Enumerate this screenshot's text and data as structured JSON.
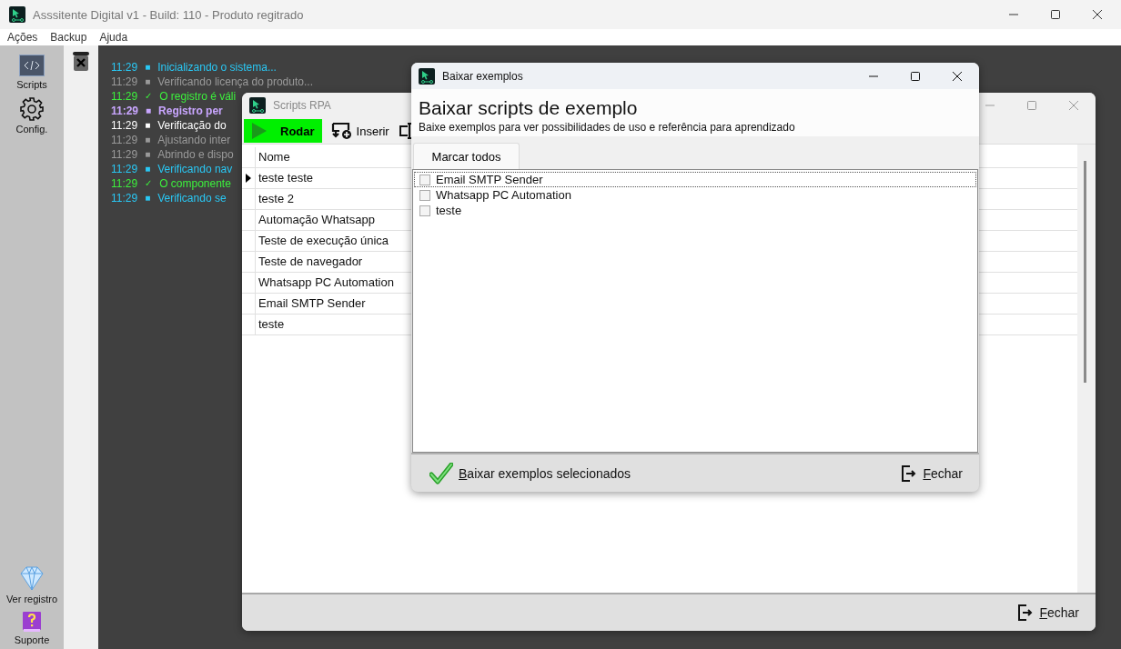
{
  "main_window": {
    "title": "Asssitente Digital v1 - Build: 110 - Produto regitrado",
    "menu": [
      "Ações",
      "Backup",
      "Ajuda"
    ]
  },
  "sidebar": {
    "items": [
      {
        "label": "Scripts",
        "kind": "code"
      },
      {
        "label": "Config.",
        "kind": "gear"
      },
      {
        "label": "Ver registro",
        "kind": "diamond"
      },
      {
        "label": "Suporte",
        "kind": "help"
      }
    ]
  },
  "log": [
    {
      "time": "11:29",
      "mark": "■",
      "text": "Inicializando o sistema...",
      "kind": "info"
    },
    {
      "time": "11:29",
      "mark": "■",
      "text": "Verificando licença do produto...",
      "kind": "muted"
    },
    {
      "time": "11:29",
      "mark": "✓",
      "text": "O registro é váli",
      "kind": "ok"
    },
    {
      "time": "11:29",
      "mark": "■",
      "text": "Registro per",
      "kind": "highlight"
    },
    {
      "time": "11:29",
      "mark": "■",
      "text": "Verificação do",
      "kind": "plain"
    },
    {
      "time": "11:29",
      "mark": "■",
      "text": "Ajustando inter",
      "kind": "muted"
    },
    {
      "time": "11:29",
      "mark": "■",
      "text": "Abrindo e dispo",
      "kind": "muted"
    },
    {
      "time": "11:29",
      "mark": "■",
      "text": "Verificando nav",
      "kind": "info"
    },
    {
      "time": "11:29",
      "mark": "✓",
      "text": "O componente",
      "kind": "ok"
    },
    {
      "time": "11:29",
      "mark": "■",
      "text": "Verificando se",
      "kind": "info"
    }
  ],
  "scripts_window": {
    "title": "Scripts RPA",
    "toolbar": [
      {
        "label": "Rodar",
        "kind": "run"
      },
      {
        "label": "Inserir",
        "kind": "insert"
      },
      {
        "kind": "rename"
      }
    ],
    "table": {
      "columns": [
        "Nome"
      ],
      "rows": [
        {
          "name": "teste teste",
          "selected": true
        },
        {
          "name": "teste 2",
          "selected": false
        },
        {
          "name": "Automação Whatsapp",
          "selected": false
        },
        {
          "name": "Teste de execução única",
          "selected": false
        },
        {
          "name": "Teste de navegador",
          "selected": false
        },
        {
          "name": "Whatsapp PC Automation",
          "selected": false
        },
        {
          "name": "Email SMTP Sender",
          "selected": false
        },
        {
          "name": "teste",
          "selected": false
        }
      ]
    },
    "close_button": "Fechar"
  },
  "dialog": {
    "title": "Baixar exemplos",
    "heading": "Baixar scripts de exemplo",
    "subtitle": "Baixe exemplos para ver possibilidades de uso e referência para aprendizado",
    "select_all_button": "Marcar todos",
    "items": [
      {
        "label": "Email SMTP Sender",
        "checked": false,
        "focused": true
      },
      {
        "label": "Whatsapp PC Automation",
        "checked": false,
        "focused": false
      },
      {
        "label": "teste",
        "checked": false,
        "focused": false
      }
    ],
    "download_button": "Baixar exemplos selecionados",
    "close_button": "Fechar"
  }
}
